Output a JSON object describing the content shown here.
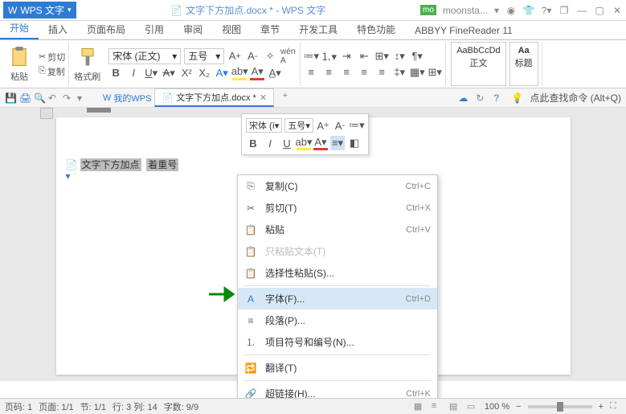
{
  "app": {
    "name": "WPS 文字"
  },
  "title": {
    "doc": "文字下方加点.docx * - WPS 文字",
    "user": "moonsta...",
    "user_badge": "mo"
  },
  "tabs": [
    "开始",
    "插入",
    "页面布局",
    "引用",
    "审阅",
    "视图",
    "章节",
    "开发工具",
    "特色功能",
    "ABBYY FineReader 11"
  ],
  "clipboard": {
    "paste": "粘贴",
    "cut": "剪切",
    "copy": "复制",
    "fmt_painter": "格式刷"
  },
  "font": {
    "name": "宋体 (正文)",
    "size": "五号"
  },
  "styles": {
    "normal_preview": "AaBbCcDd",
    "normal": "正文",
    "heading_preview": "Aa",
    "heading": "标题"
  },
  "qat": {
    "my_wps": "我的WPS",
    "doc_tab": "文字下方加点.docx *",
    "cmd_hint": "点此查找命令 (Alt+Q)"
  },
  "doc": {
    "selected1": "文字下方加点",
    "selected2": "着重号"
  },
  "mini": {
    "font": "宋体 (ī",
    "size": "五号"
  },
  "ctx": {
    "copy": "复制(C)",
    "copy_sc": "Ctrl+C",
    "cut": "剪切(T)",
    "cut_sc": "Ctrl+X",
    "paste": "粘贴",
    "paste_sc": "Ctrl+V",
    "paste_text": "只粘贴文本(T)",
    "paste_special": "选择性粘贴(S)...",
    "font": "字体(F)...",
    "font_sc": "Ctrl+D",
    "paragraph": "段落(P)...",
    "bullets": "项目符号和编号(N)...",
    "translate": "翻译(T)",
    "hyperlink": "超链接(H)...",
    "hyperlink_sc": "Ctrl+K"
  },
  "status": {
    "page": "页码: 1",
    "pages": "页面: 1/1",
    "section": "节: 1/1",
    "pos": "行: 3  列: 14",
    "words": "字数: 9/9",
    "zoom": "100 %"
  }
}
